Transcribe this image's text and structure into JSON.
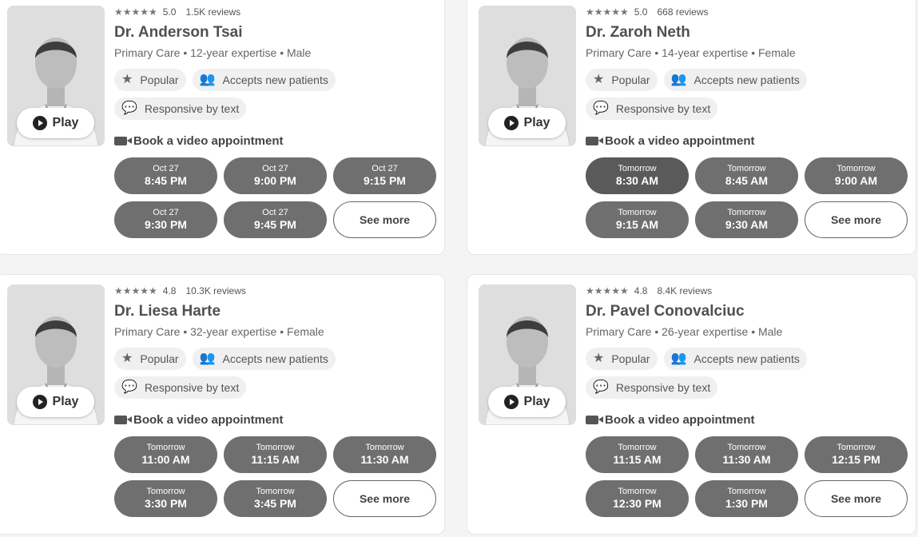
{
  "doctors": [
    {
      "stars": "★★★★★",
      "rating": "5.0",
      "reviews": "1.5K reviews",
      "name": "Dr. Anderson Tsai",
      "meta": "Primary Care • 12-year expertise • Male",
      "play_label": "Play",
      "badges": [
        {
          "icon": "star-icon",
          "glyph": "★",
          "label": "Popular"
        },
        {
          "icon": "users-icon",
          "glyph": "👥",
          "label": "Accepts new patients"
        },
        {
          "icon": "message-icon",
          "glyph": "💬",
          "label": "Responsive by text"
        }
      ],
      "book_label": "Book a video appointment",
      "slots": [
        {
          "day": "Oct 27",
          "time": "8:45 PM"
        },
        {
          "day": "Oct 27",
          "time": "9:00 PM"
        },
        {
          "day": "Oct 27",
          "time": "9:15 PM"
        },
        {
          "day": "Oct 27",
          "time": "9:30 PM"
        },
        {
          "day": "Oct 27",
          "time": "9:45 PM"
        }
      ],
      "see_more": "See more"
    },
    {
      "stars": "★★★★★",
      "rating": "5.0",
      "reviews": "668 reviews",
      "name": "Dr. Zaroh Neth",
      "meta": "Primary Care • 14-year expertise • Female",
      "play_label": "Play",
      "badges": [
        {
          "icon": "star-icon",
          "glyph": "★",
          "label": "Popular"
        },
        {
          "icon": "users-icon",
          "glyph": "👥",
          "label": "Accepts new patients"
        },
        {
          "icon": "message-icon",
          "glyph": "💬",
          "label": "Responsive by text"
        }
      ],
      "book_label": "Book a video appointment",
      "slots": [
        {
          "day": "Tomorrow",
          "time": "8:30 AM"
        },
        {
          "day": "Tomorrow",
          "time": "8:45 AM"
        },
        {
          "day": "Tomorrow",
          "time": "9:00 AM"
        },
        {
          "day": "Tomorrow",
          "time": "9:15 AM"
        },
        {
          "day": "Tomorrow",
          "time": "9:30 AM"
        }
      ],
      "see_more": "See more"
    },
    {
      "stars": "★★★★★",
      "rating": "4.8",
      "reviews": "10.3K reviews",
      "name": "Dr. Liesa Harte",
      "meta": "Primary Care • 32-year expertise • Female",
      "play_label": "Play",
      "badges": [
        {
          "icon": "star-icon",
          "glyph": "★",
          "label": "Popular"
        },
        {
          "icon": "users-icon",
          "glyph": "👥",
          "label": "Accepts new patients"
        },
        {
          "icon": "message-icon",
          "glyph": "💬",
          "label": "Responsive by text"
        }
      ],
      "book_label": "Book a video appointment",
      "slots": [
        {
          "day": "Tomorrow",
          "time": "11:00 AM"
        },
        {
          "day": "Tomorrow",
          "time": "11:15 AM"
        },
        {
          "day": "Tomorrow",
          "time": "11:30 AM"
        },
        {
          "day": "Tomorrow",
          "time": "3:30 PM"
        },
        {
          "day": "Tomorrow",
          "time": "3:45 PM"
        }
      ],
      "see_more": "See more"
    },
    {
      "stars": "★★★★★",
      "rating": "4.8",
      "reviews": "8.4K reviews",
      "name": "Dr. Pavel Conovalciuc",
      "meta": "Primary Care • 26-year expertise • Male",
      "play_label": "Play",
      "badges": [
        {
          "icon": "star-icon",
          "glyph": "★",
          "label": "Popular"
        },
        {
          "icon": "users-icon",
          "glyph": "👥",
          "label": "Accepts new patients"
        },
        {
          "icon": "message-icon",
          "glyph": "💬",
          "label": "Responsive by text"
        }
      ],
      "book_label": "Book a video appointment",
      "slots": [
        {
          "day": "Tomorrow",
          "time": "11:15 AM"
        },
        {
          "day": "Tomorrow",
          "time": "11:30 AM"
        },
        {
          "day": "Tomorrow",
          "time": "12:15 PM"
        },
        {
          "day": "Tomorrow",
          "time": "12:30 PM"
        },
        {
          "day": "Tomorrow",
          "time": "1:30 PM"
        }
      ],
      "see_more": "See more"
    }
  ]
}
